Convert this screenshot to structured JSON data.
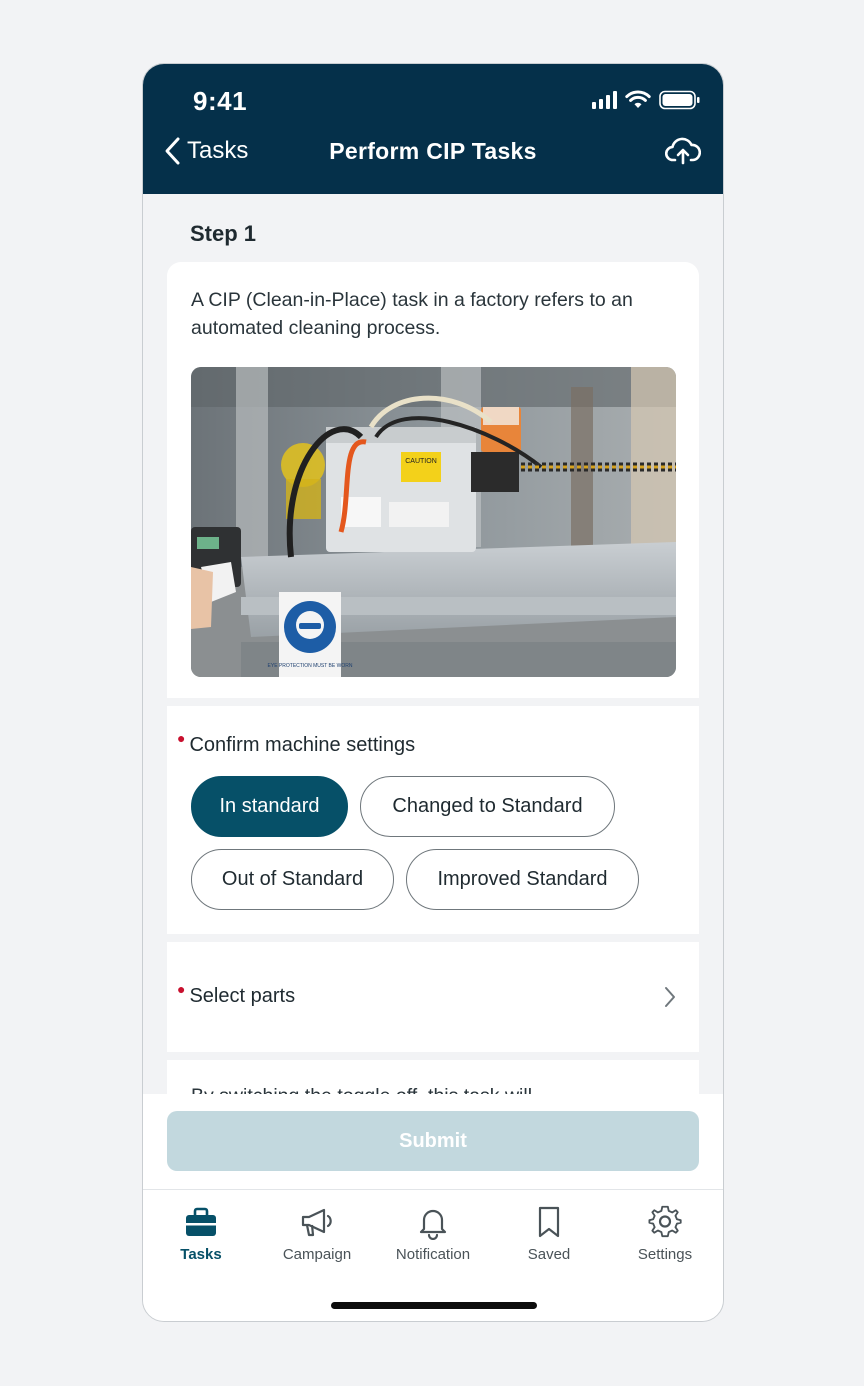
{
  "status_bar": {
    "time": "9:41"
  },
  "nav": {
    "back_label": "Tasks",
    "title": "Perform CIP Tasks"
  },
  "step": {
    "label": "Step 1"
  },
  "intro": {
    "text": "A CIP (Clean-in-Place) task in a factory refers to an automated cleaning process.",
    "photo_signs": {
      "caution": "CAUTION",
      "ppe": "EYE PROTECTION MUST BE WORN"
    }
  },
  "confirm": {
    "label": "Confirm machine settings",
    "required": true,
    "options": [
      "In standard",
      "Changed to Standard",
      "Out of Standard",
      "Improved Standard"
    ],
    "selected": "In standard"
  },
  "parts": {
    "label": "Select parts",
    "required": true
  },
  "toggle_note": {
    "text": "By switching the toggle off, this task will"
  },
  "submit": {
    "label": "Submit"
  },
  "tabs": [
    {
      "label": "Tasks",
      "icon": "briefcase-icon",
      "active": true
    },
    {
      "label": "Campaign",
      "icon": "megaphone-icon",
      "active": false
    },
    {
      "label": "Notification",
      "icon": "bell-icon",
      "active": false
    },
    {
      "label": "Saved",
      "icon": "bookmark-icon",
      "active": false
    },
    {
      "label": "Settings",
      "icon": "gear-icon",
      "active": false
    }
  ],
  "colors": {
    "header_bg": "#05304a",
    "accent": "#065068",
    "required": "#c8102e",
    "submit_disabled": "#c2d8de"
  }
}
